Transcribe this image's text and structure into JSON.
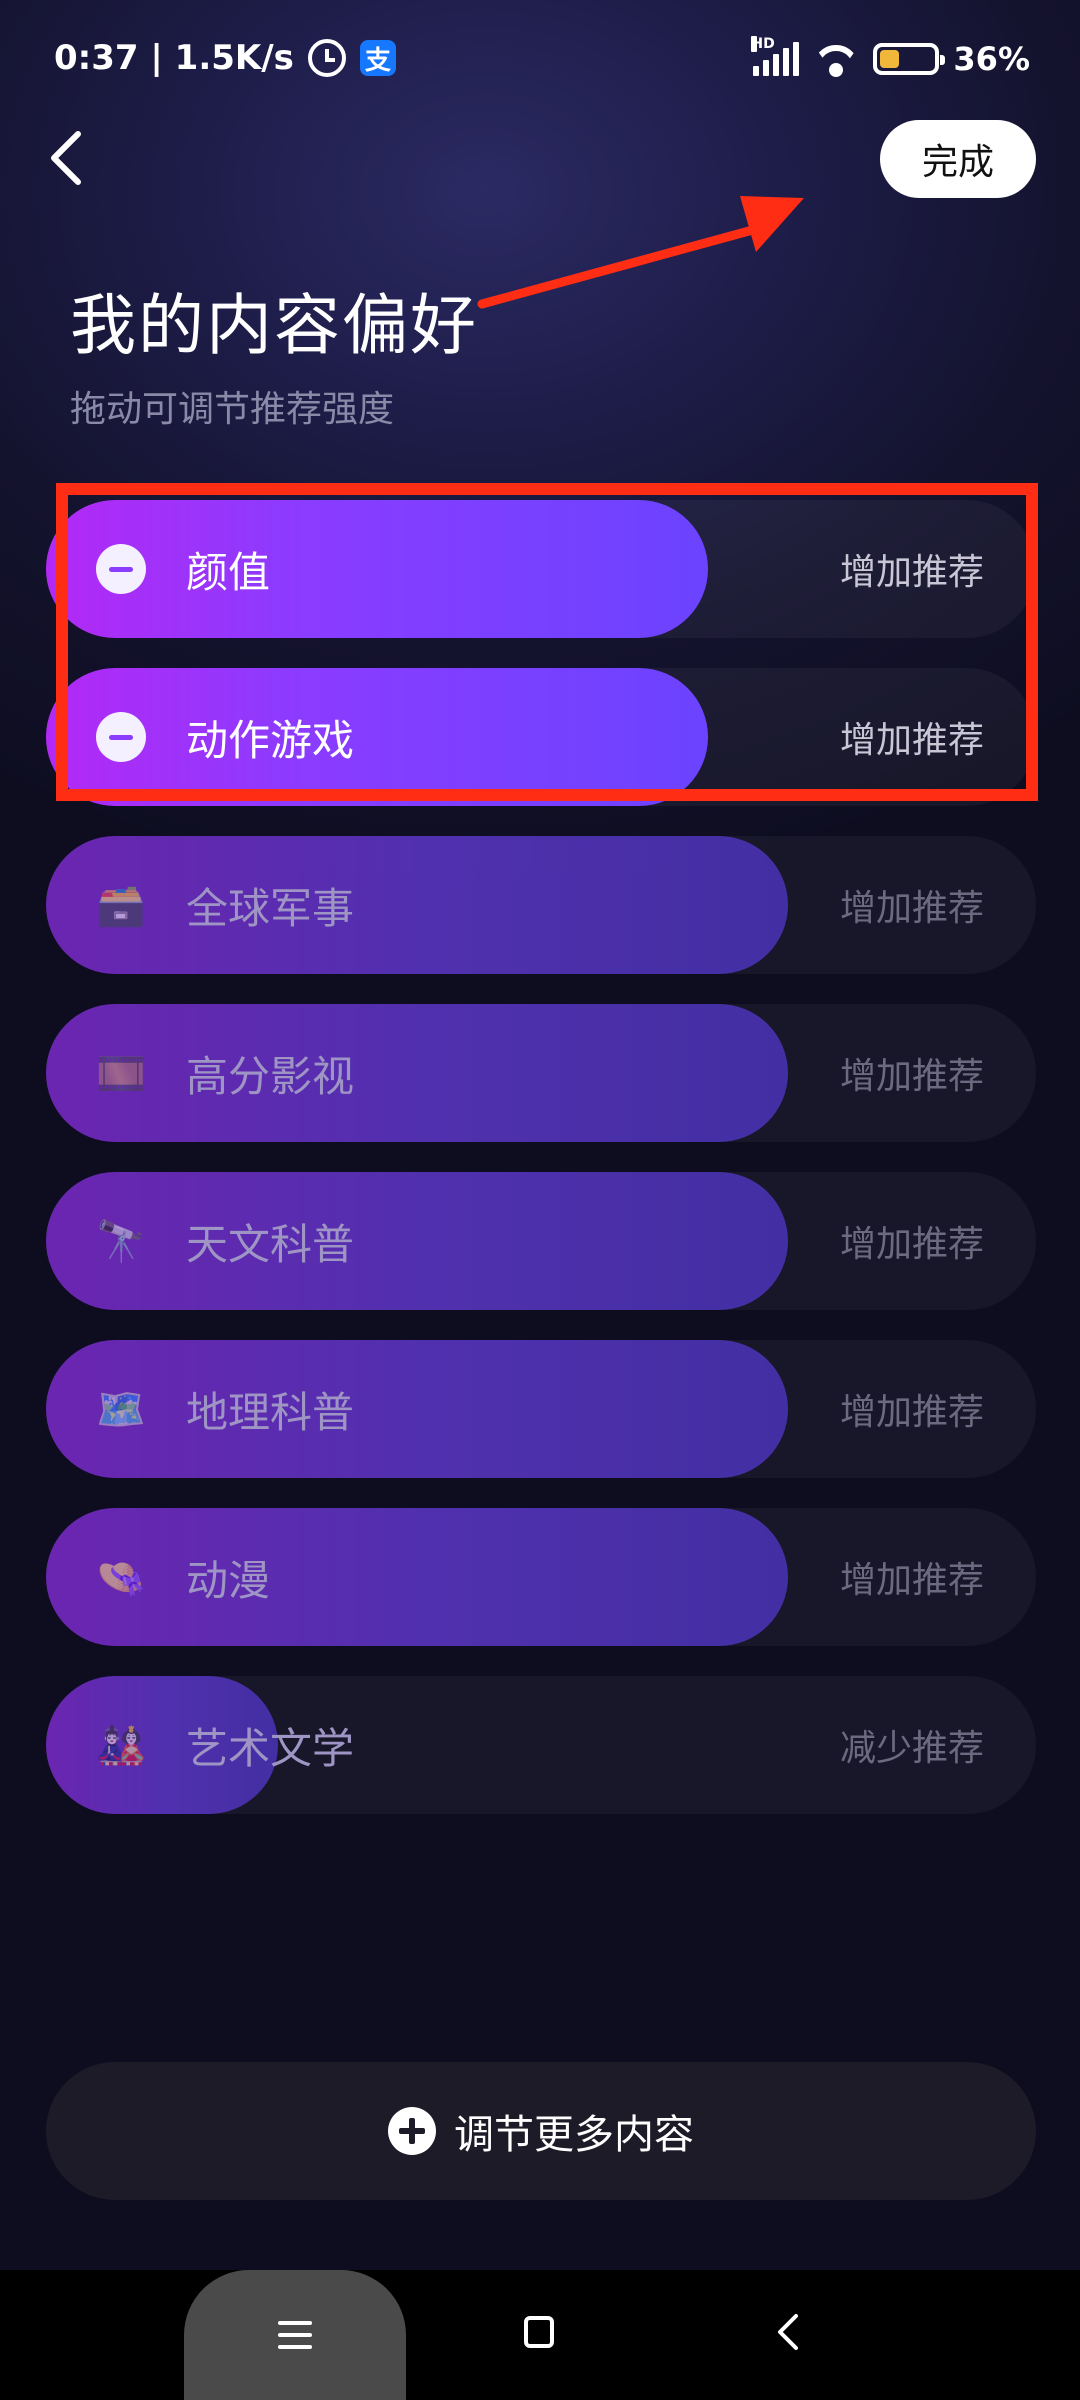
{
  "status_bar": {
    "time_speed": "0:37 | 1.5K/s",
    "alarm_icon": "alarm-icon",
    "alipay_glyph": "支",
    "signal_label": "HD",
    "battery_percent": "36%",
    "battery_level": 0.36
  },
  "header": {
    "done_label": "完成",
    "title": "我的内容偏好",
    "subtitle": "拖动可调节推荐强度"
  },
  "preferences": [
    {
      "label": "颜值",
      "action": "增加推荐",
      "state": "active",
      "icon": "minus-icon"
    },
    {
      "label": "动作游戏",
      "action": "增加推荐",
      "state": "active",
      "icon": "minus-icon"
    },
    {
      "label": "全球军事",
      "action": "增加推荐",
      "state": "inactive",
      "icon": "🗃️"
    },
    {
      "label": "高分影视",
      "action": "增加推荐",
      "state": "inactive",
      "icon": "🎞️"
    },
    {
      "label": "天文科普",
      "action": "增加推荐",
      "state": "inactive",
      "icon": "🔭"
    },
    {
      "label": "地理科普",
      "action": "增加推荐",
      "state": "inactive",
      "icon": "🗺️"
    },
    {
      "label": "动漫",
      "action": "增加推荐",
      "state": "inactive",
      "icon": "👒"
    },
    {
      "label": "艺术文学",
      "action": "减少推荐",
      "state": "inactive",
      "icon": "🎎"
    }
  ],
  "more_button_label": "调节更多内容",
  "colors": {
    "accent": "#8a3cff",
    "annotation": "#ff2d14"
  }
}
